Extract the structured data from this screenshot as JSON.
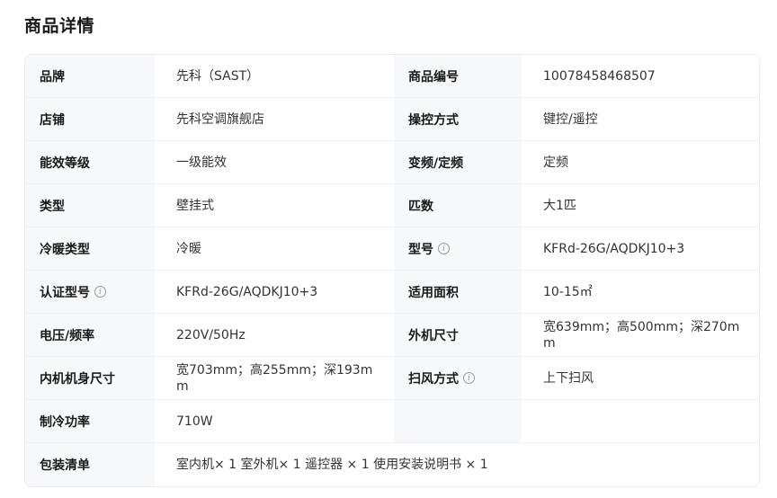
{
  "page_title": "商品详情",
  "specs": {
    "brand_label": "品牌",
    "brand_value": "先科（SAST）",
    "sku_label": "商品编号",
    "sku_value": "10078458468507",
    "shop_label": "店铺",
    "shop_value": "先科空调旗舰店",
    "control_label": "操控方式",
    "control_value": "键控/遥控",
    "energy_label": "能效等级",
    "energy_value": "一级能效",
    "freq_label": "变频/定频",
    "freq_value": "定频",
    "type_label": "类型",
    "type_value": "壁挂式",
    "hp_label": "匹数",
    "hp_value": "大1匹",
    "heatcool_label": "冷暖类型",
    "heatcool_value": "冷暖",
    "model_label": "型号",
    "model_value": "KFRd-26G/AQDKJ10+3",
    "cert_model_label": "认证型号",
    "cert_model_value": "KFRd-26G/AQDKJ10+3",
    "area_label": "适用面积",
    "area_value": "10-15㎡",
    "voltage_label": "电压/频率",
    "voltage_value": "220V/50Hz",
    "outdoor_size_label": "外机尺寸",
    "outdoor_size_value": "宽639mm；高500mm；深270mm",
    "indoor_size_label": "内机机身尺寸",
    "indoor_size_value": "宽703mm；高255mm；深193mm",
    "swing_label": "扫风方式",
    "swing_value": "上下扫风",
    "cooling_power_label": "制冷功率",
    "cooling_power_value": "710W",
    "package_label": "包装清单",
    "package_value": "室内机× 1 室外机× 1 遥控器 × 1 使用安装说明书 × 1"
  },
  "icons": {
    "info": "info-circle-icon",
    "info_glyph": "i"
  }
}
